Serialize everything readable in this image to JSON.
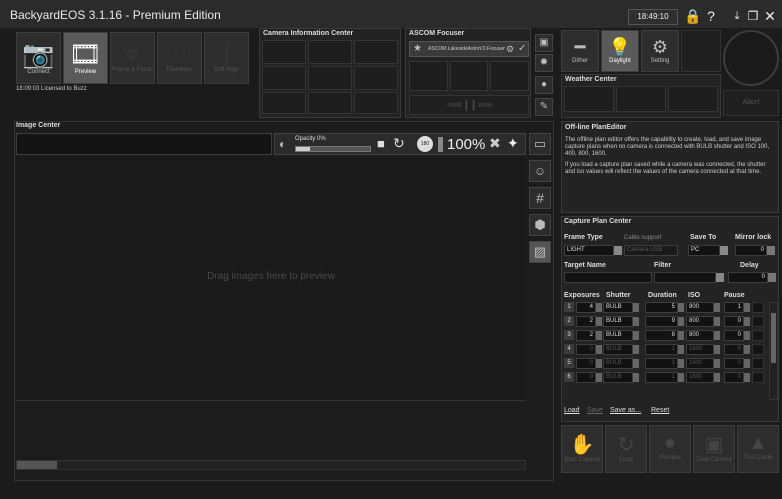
{
  "titlebar": {
    "title": "BackyardEOS 3.1.16 - Premium Edition",
    "clock": "18:49:10",
    "lock_icon": "lock-icon",
    "help_icon": "help-icon"
  },
  "toolbar": {
    "connect": "Connect",
    "preview": "Preview",
    "frame_focus": "Frame & Focus",
    "planetary": "Planetary",
    "drift_align": "Drift Align",
    "status": "18:09:03  Licensed to Buzz"
  },
  "camera_info": {
    "header": "Camera Information Center"
  },
  "ascom": {
    "header": "ASCOM Focuser",
    "device": "ASCOM.LakesideAstroV2.Focuser"
  },
  "right_top": {
    "dither": "Dither",
    "daylight": "Daylight",
    "setting": "Setting",
    "weather_header": "Weather Center",
    "abort": "Abort"
  },
  "image_center": {
    "header": "Image Center",
    "opacity_label": "Opacity 0%",
    "zoom": "100%",
    "drop_hint": "Drag images here to preview"
  },
  "offline": {
    "header": "Off-line PlanEditor",
    "p1": "The offline plan editor offers the capability to create, load, and save image capture plans when no camera is connected with BULB shutter and ISO 100, 400, 800, 1600.",
    "p2": "If you load a capture plan saved while a camera was connected, the shutter and iso values will reflect the values of the camera connected at that time."
  },
  "capture_plan": {
    "header": "Capture Plan Center",
    "frame_type_label": "Frame Type",
    "frame_type": "LIGHT",
    "cable_label": "Cable support",
    "cable_value": "Camera USB",
    "save_to_label": "Save To",
    "save_to": "PC",
    "mirror_label": "Mirror lock",
    "mirror_value": "0",
    "target_label": "Target Name",
    "filter_label": "Filter",
    "delay_label": "Delay",
    "delay_value": "0",
    "cols": {
      "exposures": "Exposures",
      "shutter": "Shutter",
      "duration": "Duration",
      "iso": "ISO",
      "pause": "Pause"
    },
    "rows": [
      {
        "n": "1",
        "exp": "4",
        "shutter": "BULB",
        "dur": "5",
        "iso": "800",
        "pause": "1",
        "active": true
      },
      {
        "n": "2",
        "exp": "2",
        "shutter": "BULB",
        "dur": "9",
        "iso": "800",
        "pause": "0",
        "active": true
      },
      {
        "n": "3",
        "exp": "2",
        "shutter": "BULB",
        "dur": "8",
        "iso": "800",
        "pause": "0",
        "active": true
      },
      {
        "n": "4",
        "exp": "0",
        "shutter": "BULB",
        "dur": "1",
        "iso": "1600",
        "pause": "0",
        "active": false
      },
      {
        "n": "5",
        "exp": "0",
        "shutter": "BULB",
        "dur": "1",
        "iso": "1600",
        "pause": "0",
        "active": false
      },
      {
        "n": "6",
        "exp": "0",
        "shutter": "BULB",
        "dur": "1",
        "iso": "1600",
        "pause": "0",
        "active": false
      }
    ],
    "load": "Load",
    "save": "Save",
    "save_as": "Save as...",
    "reset": "Reset"
  },
  "bottom_actions": {
    "start": "Start Capture",
    "loop": "Loop",
    "preview": "Preview",
    "dual": "Dual Camera",
    "tool": "Tool Cable"
  }
}
